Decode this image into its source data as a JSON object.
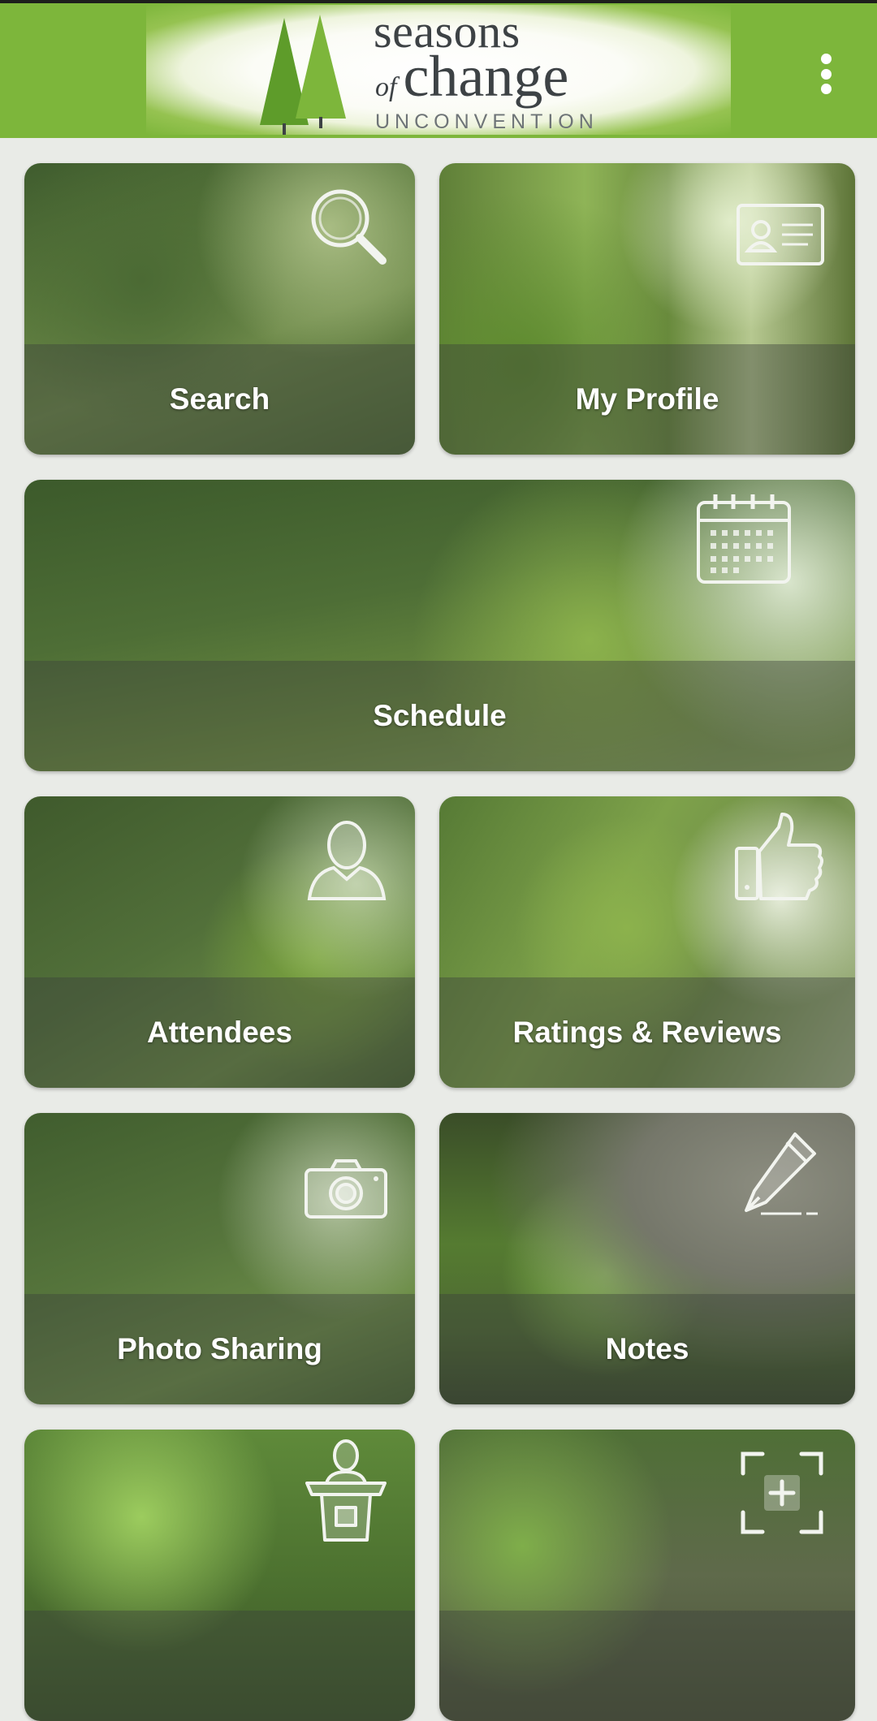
{
  "app": {
    "logo": {
      "line1": "seasons",
      "line2_prefix": "of",
      "line2_word": "change",
      "line3": "UNCONVENTION"
    },
    "menu_icon": "more-vert-icon",
    "colors": {
      "header_green": "#7db63b",
      "page_background": "#e9ebe7",
      "label_text": "#ffffff"
    }
  },
  "tiles": [
    {
      "label": "Search",
      "icon": "search-icon"
    },
    {
      "label": "My Profile",
      "icon": "id-card-icon"
    },
    {
      "label": "Schedule",
      "icon": "calendar-icon"
    },
    {
      "label": "Attendees",
      "icon": "person-icon"
    },
    {
      "label": "Ratings & Reviews",
      "icon": "thumbs-up-icon"
    },
    {
      "label": "Photo Sharing",
      "icon": "camera-icon"
    },
    {
      "label": "Notes",
      "icon": "pen-icon"
    },
    {
      "label": "",
      "icon": "speaker-podium-icon"
    },
    {
      "label": "",
      "icon": "add-scan-icon"
    }
  ]
}
